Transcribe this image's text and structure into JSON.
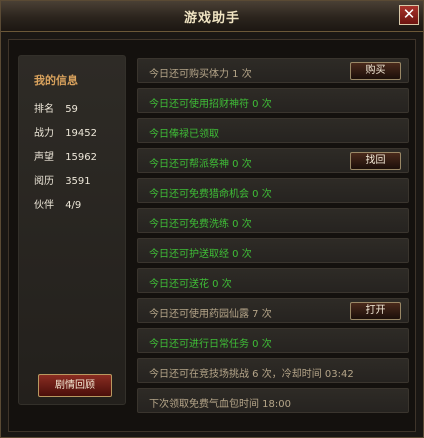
{
  "window": {
    "title": "游戏助手",
    "close_icon": "close-icon"
  },
  "info": {
    "title": "我的信息",
    "stats": [
      {
        "label": "排名",
        "value": "59"
      },
      {
        "label": "战力",
        "value": "19452"
      },
      {
        "label": "声望",
        "value": "15962"
      },
      {
        "label": "阅历",
        "value": "3591"
      },
      {
        "label": "伙伴",
        "value": "4/9"
      }
    ],
    "review_button": "剧情回顾"
  },
  "tasks": [
    {
      "text": "今日还可购买体力 1 次",
      "button": "购买",
      "color": "#b5a589"
    },
    {
      "text": "今日还可使用招财神符 0 次",
      "button": "",
      "color": "#3fbf37"
    },
    {
      "text": "今日俸禄已领取",
      "button": "",
      "color": "#3fbf37"
    },
    {
      "text": "今日还可帮派祭神 0 次",
      "button": "找回",
      "color": "#3fbf37"
    },
    {
      "text": "今日还可免费猎命机会 0 次",
      "button": "",
      "color": "#3fbf37"
    },
    {
      "text": "今日还可免费洗练 0 次",
      "button": "",
      "color": "#3fbf37"
    },
    {
      "text": "今日还可护送取经 0 次",
      "button": "",
      "color": "#3fbf37"
    },
    {
      "text": "今日还可送花 0 次",
      "button": "",
      "color": "#3fbf37"
    },
    {
      "text": "今日还可使用药园仙露 7 次",
      "button": "打开",
      "color": "#b5a589"
    },
    {
      "text": "今日还可进行日常任务 0 次",
      "button": "",
      "color": "#3fbf37"
    },
    {
      "text": "今日还可在竞技场挑战 6 次，冷却时间 03:42",
      "button": "",
      "color": "#b5a589"
    },
    {
      "text": "下次领取免费气血包时间 18:00",
      "button": "",
      "color": "#b5a589"
    }
  ]
}
